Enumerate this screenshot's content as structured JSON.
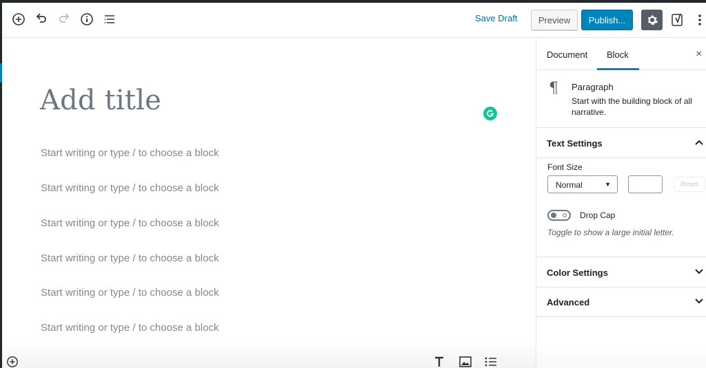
{
  "header": {
    "icons": [
      "add-block-icon",
      "undo-icon",
      "redo-icon",
      "info-icon",
      "list-view-icon"
    ],
    "save_draft_label": "Save Draft",
    "preview_label": "Preview",
    "publish_label": "Publish...",
    "settings_icon": "gear-icon",
    "yoast_icon": "yoast-icon",
    "more_icon": "more-vertical-icon"
  },
  "editor": {
    "title_placeholder": "Add title",
    "block_placeholders": [
      "Start writing or type / to choose a block",
      "Start writing or type / to choose a block",
      "Start writing or type / to choose a block",
      "Start writing or type / to choose a block",
      "Start writing or type / to choose a block",
      "Start writing or type / to choose a block"
    ],
    "inserter_icons": [
      "heading-icon",
      "image-icon",
      "list-icon"
    ]
  },
  "sidebar": {
    "tabs": [
      {
        "label": "Document",
        "active": false
      },
      {
        "label": "Block",
        "active": true
      }
    ],
    "close_label": "×",
    "block": {
      "icon": "paragraph-icon",
      "name": "Paragraph",
      "description": "Start with the building block of all narrative."
    },
    "text_settings": {
      "title": "Text Settings",
      "expanded": true,
      "font_size_label": "Font Size",
      "font_size_value": "Normal",
      "custom_size_value": "",
      "reset_label": "Reset",
      "drop_cap_label": "Drop Cap",
      "drop_cap_enabled": false,
      "drop_cap_help": "Toggle to show a large initial letter."
    },
    "color_settings": {
      "title": "Color Settings",
      "expanded": false
    },
    "advanced": {
      "title": "Advanced",
      "expanded": false
    }
  },
  "colors": {
    "accent": "#0085ba",
    "link": "#0073aa",
    "dark_toolbar": "#23282d",
    "grammarly": "#15c39a"
  }
}
